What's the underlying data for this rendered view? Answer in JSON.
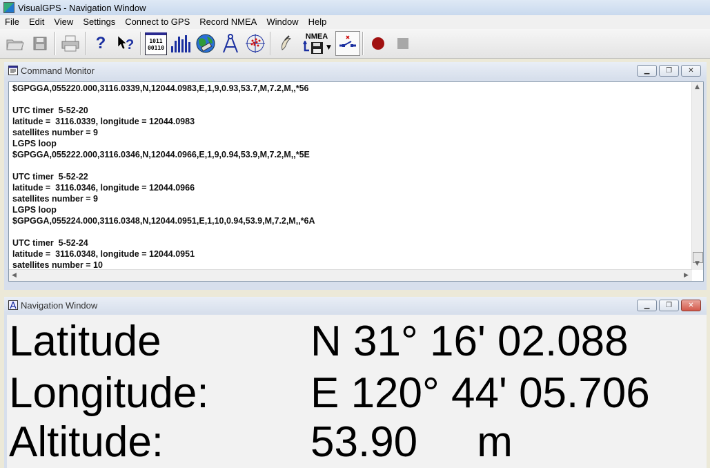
{
  "app": {
    "title": "VisualGPS - Navigation Window"
  },
  "menu": [
    "File",
    "Edit",
    "View",
    "Settings",
    "Connect to GPS",
    "Record NMEA",
    "Window",
    "Help"
  ],
  "toolbar": {
    "nmea_label": "NMEA",
    "binary_label_1": "1011",
    "binary_label_2": "00110",
    "help_q": "?",
    "help_whats": "?",
    "arrow_down": "▼"
  },
  "command_monitor": {
    "title": "Command Monitor",
    "lines": [
      "$GPGGA,055220.000,3116.0339,N,12044.0983,E,1,9,0.93,53.7,M,7.2,M,,*56",
      "",
      "UTC timer  5-52-20",
      "latitude =  3116.0339, longitude = 12044.0983",
      "satellites number = 9",
      "LGPS loop",
      "$GPGGA,055222.000,3116.0346,N,12044.0966,E,1,9,0.94,53.9,M,7.2,M,,*5E",
      "",
      "UTC timer  5-52-22",
      "latitude =  3116.0346, longitude = 12044.0966",
      "satellites number = 9",
      "LGPS loop",
      "$GPGGA,055224.000,3116.0348,N,12044.0951,E,1,10,0.94,53.9,M,7.2,M,,*6A",
      "",
      "UTC timer  5-52-24",
      "latitude =  3116.0348, longitude = 12044.0951",
      "satellites number = 10"
    ]
  },
  "navigation_window": {
    "title": "Navigation Window",
    "latitude_label": "Latitude",
    "latitude_value": "N 31° 16' 02.088",
    "longitude_label": "Longitude:",
    "longitude_value": "E 120° 44' 05.706",
    "altitude_label": "Altitude:",
    "altitude_value": "53.90     m"
  },
  "colors": {
    "record_red": "#a01010",
    "stop_gray": "#a8a8a8",
    "close_red": "#d3584a"
  }
}
